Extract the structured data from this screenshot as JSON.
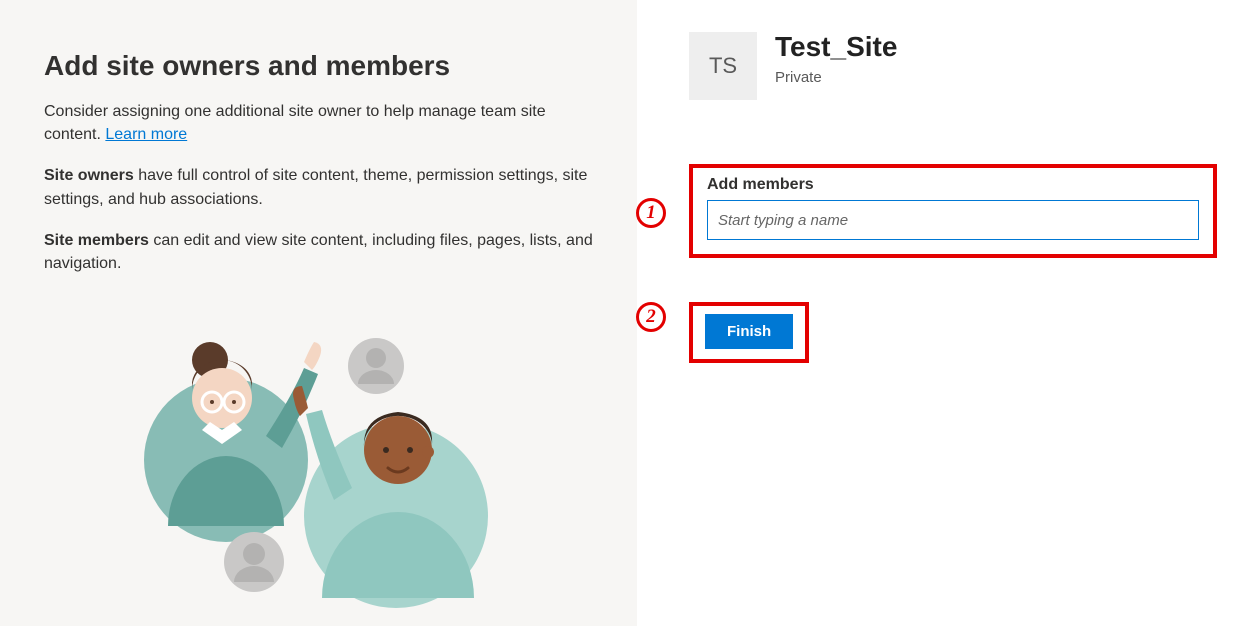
{
  "left": {
    "title": "Add site owners and members",
    "intro_prefix": "Consider assigning one additional site owner to help manage team site content. ",
    "learn_more": "Learn more",
    "owners_bold": "Site owners",
    "owners_rest": " have full control of site content, theme, permission settings, site settings, and hub associations.",
    "members_bold": "Site members",
    "members_rest": " can edit and view site content, including files, pages, lists, and navigation."
  },
  "right": {
    "site_initials": "TS",
    "site_name": "Test_Site",
    "site_privacy": "Private",
    "add_members_label": "Add members",
    "add_members_placeholder": "Start typing a name",
    "finish_label": "Finish"
  },
  "callouts": {
    "one": "1",
    "two": "2"
  }
}
